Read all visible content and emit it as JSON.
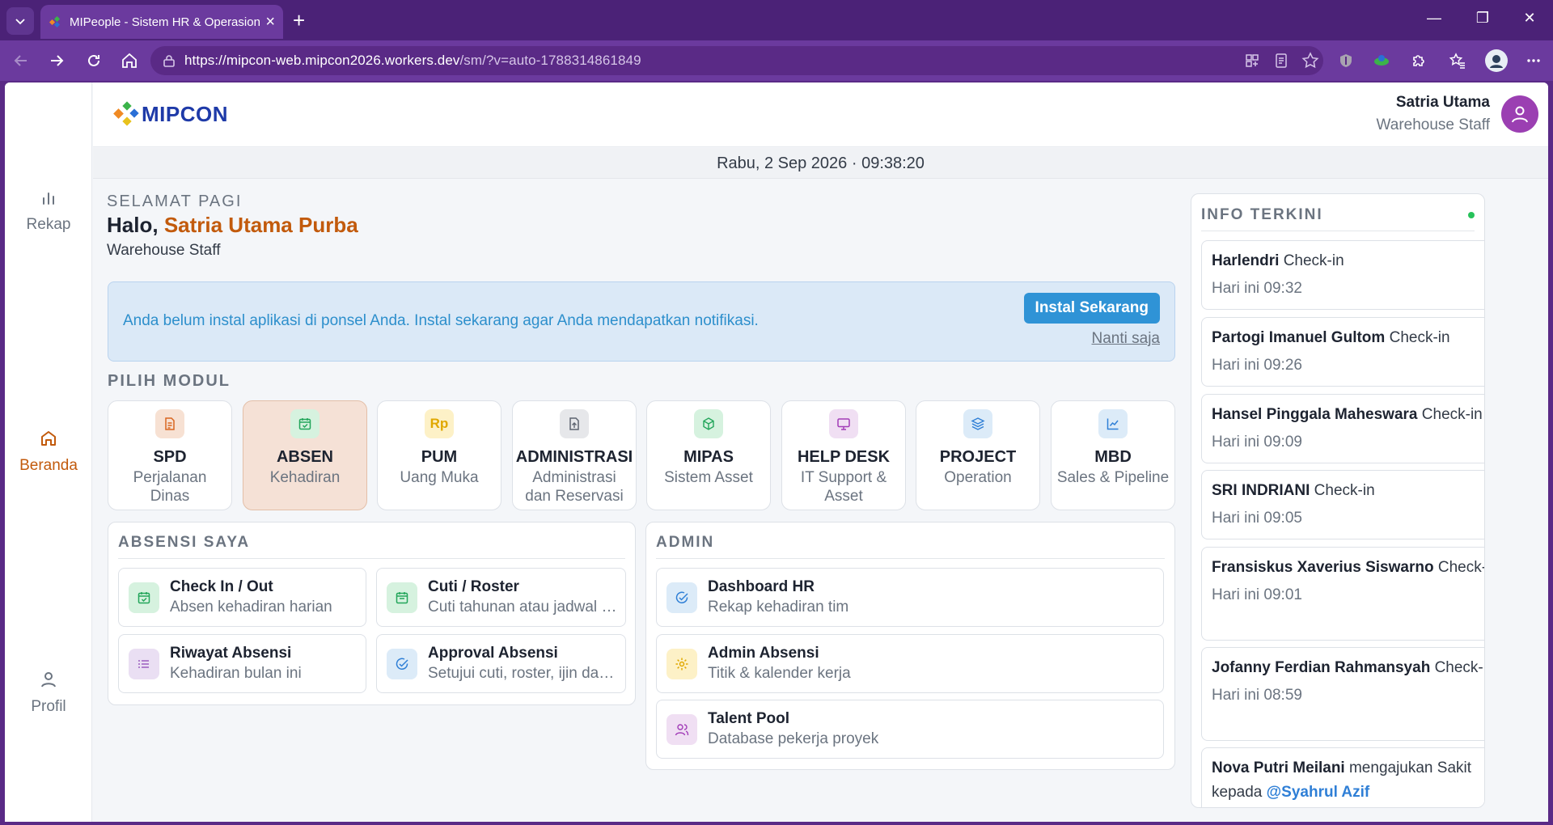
{
  "browser": {
    "tab_title": "MIPeople - Sistem HR & Operasional",
    "url_host": "https://mipcon-web.mipcon2026.workers.dev",
    "url_path": "/sm/?v=auto-1788314861849"
  },
  "rail": {
    "rekap": "Rekap",
    "beranda": "Beranda",
    "profil": "Profil"
  },
  "header": {
    "logo": "MIPCON",
    "user_name": "Satria Utama",
    "user_role": "Warehouse Staff"
  },
  "datetime": "Rabu, 2 Sep 2026 · 09:38:20",
  "greeting": {
    "subtitle": "SELAMAT PAGI",
    "hello": "Halo,",
    "name": "Satria Utama Purba",
    "role": "Warehouse Staff"
  },
  "banner": {
    "text": "Anda belum instal aplikasi di ponsel Anda. Instal sekarang agar Anda mendapatkan notifikasi.",
    "install": "Instal Sekarang",
    "later": "Nanti saja"
  },
  "modules_title": "PILIH MODUL",
  "modules": [
    {
      "title": "SPD",
      "sub": "Perjalanan Dinas",
      "icon": "document-icon",
      "color": "#f7e1d3"
    },
    {
      "title": "ABSEN",
      "sub": "Kehadiran",
      "icon": "calendar-check-icon",
      "color": "#d6f2df"
    },
    {
      "title": "PUM",
      "sub": "Uang Muka",
      "icon": "rupiah-icon",
      "color": "#fdf1c7"
    },
    {
      "title": "ADMINISTRASI",
      "sub": "Administrasi dan Reservasi",
      "icon": "file-upload-icon",
      "color": "#e6e7ea"
    },
    {
      "title": "MIPAS",
      "sub": "Sistem Asset",
      "icon": "box-icon",
      "color": "#d6f2df"
    },
    {
      "title": "HELP DESK",
      "sub": "IT Support & Asset",
      "icon": "monitor-icon",
      "color": "#f0dff3"
    },
    {
      "title": "PROJECT",
      "sub": "Operation",
      "icon": "layers-icon",
      "color": "#dcebf8"
    },
    {
      "title": "MBD",
      "sub": "Sales & Pipeline",
      "icon": "chart-line-icon",
      "color": "#dcebf8"
    }
  ],
  "absensi": {
    "title": "ABSENSI SAYA",
    "items": [
      {
        "title": "Check In / Out",
        "sub": "Absen kehadiran harian",
        "icon": "calendar-check-icon"
      },
      {
        "title": "Cuti / Roster",
        "sub": "Cuti tahunan atau jadwal roster",
        "icon": "calendar-icon"
      },
      {
        "title": "Riwayat Absensi",
        "sub": "Kehadiran bulan ini",
        "icon": "list-icon"
      },
      {
        "title": "Approval Absensi",
        "sub": "Setujui cuti, roster, ijin dan sakit",
        "icon": "check-circle-icon"
      }
    ]
  },
  "admin": {
    "title": "ADMIN",
    "items": [
      {
        "title": "Dashboard HR",
        "sub": "Rekap kehadiran tim",
        "icon": "check-circle-icon"
      },
      {
        "title": "Admin Absensi",
        "sub": "Titik & kalender kerja",
        "icon": "gear-icon"
      },
      {
        "title": "Talent Pool",
        "sub": "Database pekerja proyek",
        "icon": "users-icon"
      }
    ]
  },
  "info": {
    "title": "INFO TERKINI",
    "items": [
      {
        "name": "Harlendri",
        "action": " Check-in",
        "time": "Hari ini 09:32"
      },
      {
        "name": "Partogi Imanuel Gultom",
        "action": " Check-in",
        "time": "Hari ini 09:26"
      },
      {
        "name": "Hansel Pinggala Maheswara",
        "action": " Check-in",
        "time": "Hari ini 09:09"
      },
      {
        "name": "SRI INDRIANI",
        "action": " Check-in",
        "time": "Hari ini 09:05"
      },
      {
        "name": "Fransiskus Xaverius Siswarno",
        "action": " Check-in",
        "time": "Hari ini 09:01"
      },
      {
        "name": "Jofanny Ferdian Rahmansyah",
        "action": " Check-in",
        "time": "Hari ini 08:59"
      },
      {
        "name": "Nova Putri Meilani",
        "action": " mengajukan Sakit kepada ",
        "mention": "@Syahrul Azif",
        "time": ""
      }
    ]
  }
}
